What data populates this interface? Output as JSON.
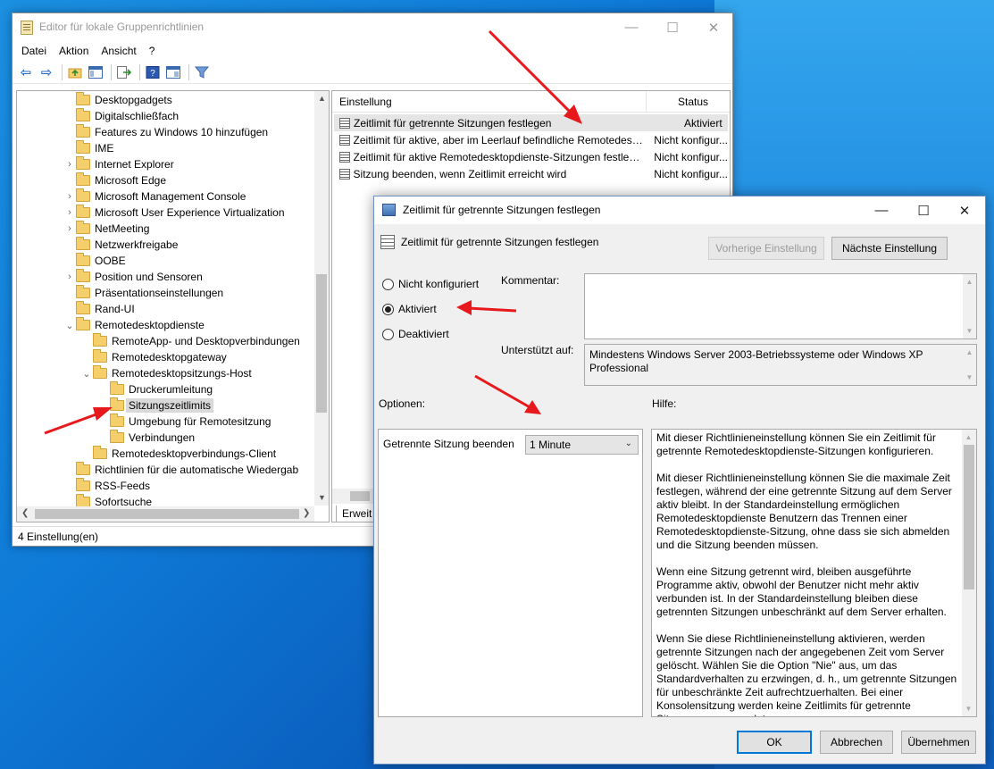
{
  "editor": {
    "title": "Editor für lokale Gruppenrichtlinien",
    "menu": [
      "Datei",
      "Aktion",
      "Ansicht",
      "?"
    ],
    "tree_items": [
      {
        "label": "Desktopgadgets",
        "expander": ""
      },
      {
        "label": "Digitalschließfach",
        "expander": ""
      },
      {
        "label": "Features zu Windows 10 hinzufügen",
        "expander": ""
      },
      {
        "label": "IME",
        "expander": ""
      },
      {
        "label": "Internet Explorer",
        "expander": ">"
      },
      {
        "label": "Microsoft Edge",
        "expander": ""
      },
      {
        "label": "Microsoft Management Console",
        "expander": ">"
      },
      {
        "label": "Microsoft User Experience Virtualization",
        "expander": ">"
      },
      {
        "label": "NetMeeting",
        "expander": ">"
      },
      {
        "label": "Netzwerkfreigabe",
        "expander": ""
      },
      {
        "label": "OOBE",
        "expander": ""
      },
      {
        "label": "Position und Sensoren",
        "expander": ">"
      },
      {
        "label": "Präsentationseinstellungen",
        "expander": ""
      },
      {
        "label": "Rand-UI",
        "expander": ""
      },
      {
        "label": "Remotedesktopdienste",
        "expander": "v"
      },
      {
        "label": "RemoteApp- und Desktopverbindungen",
        "expander": ""
      },
      {
        "label": "Remotedesktopgateway",
        "expander": ""
      },
      {
        "label": "Remotedesktopsitzungs-Host",
        "expander": "v"
      },
      {
        "label": "Druckerumleitung",
        "expander": ""
      },
      {
        "label": "Sitzungszeitlimits",
        "expander": ""
      },
      {
        "label": "Umgebung für Remotesitzung",
        "expander": ""
      },
      {
        "label": "Verbindungen",
        "expander": ""
      },
      {
        "label": "Remotedesktopverbindungs-Client",
        "expander": ""
      },
      {
        "label": "Richtlinien für die automatische Wiedergab",
        "expander": ""
      },
      {
        "label": "RSS-Feeds",
        "expander": ""
      },
      {
        "label": "Sofortsuche",
        "expander": ""
      }
    ],
    "list_header": {
      "setting": "Einstellung",
      "status": "Status"
    },
    "list_rows": [
      {
        "name": "Zeitlimit für getrennte Sitzungen festlegen",
        "status": "Aktiviert"
      },
      {
        "name": "Zeitlimit für aktive, aber im Leerlauf befindliche Remotedesk...",
        "status": "Nicht konfigur..."
      },
      {
        "name": "Zeitlimit für aktive Remotedesktopdienste-Sitzungen festleg...",
        "status": "Nicht konfigur..."
      },
      {
        "name": "Sitzung beenden, wenn Zeitlimit erreicht wird",
        "status": "Nicht konfigur..."
      }
    ],
    "bottom_tab": "Erweit",
    "statusbar": "4 Einstellung(en)"
  },
  "dialog": {
    "title": "Zeitlimit für getrennte Sitzungen festlegen",
    "header": "Zeitlimit für getrennte Sitzungen festlegen",
    "prev_button": "Vorherige Einstellung",
    "next_button": "Nächste Einstellung",
    "radio": {
      "not_configured": "Nicht konfiguriert",
      "enabled": "Aktiviert",
      "disabled": "Deaktiviert",
      "selected": "enabled"
    },
    "comment_label": "Kommentar:",
    "supported_label": "Unterstützt auf:",
    "supported_text": "Mindestens Windows Server 2003-Betriebssysteme oder Windows XP Professional",
    "options_label": "Optionen:",
    "help_label": "Hilfe:",
    "option_name": "Getrennte Sitzung beenden",
    "option_value": "1 Minute",
    "help_text": "Mit dieser Richtlinieneinstellung können Sie ein Zeitlimit für getrennte Remotedesktopdienste-Sitzungen konfigurieren.\n\nMit dieser Richtlinieneinstellung können Sie die maximale Zeit festlegen, während der eine getrennte Sitzung auf dem Server aktiv bleibt. In der Standardeinstellung ermöglichen Remotedesktopdienste Benutzern das Trennen einer Remotedesktopdienste-Sitzung, ohne dass sie sich abmelden und die Sitzung beenden müssen.\n\nWenn eine Sitzung getrennt wird, bleiben ausgeführte Programme aktiv, obwohl der Benutzer nicht mehr aktiv verbunden ist. In der Standardeinstellung bleiben diese getrennten Sitzungen unbeschränkt auf dem Server erhalten.\n\nWenn Sie diese Richtlinieneinstellung aktivieren, werden getrennte Sitzungen nach der angegebenen Zeit vom Server gelöscht. Wählen Sie die Option \"Nie\" aus, um das Standardverhalten zu erzwingen, d. h., um getrennte Sitzungen für unbeschränkte Zeit aufrechtzuerhalten. Bei einer Konsolensitzung werden keine Zeitlimits für getrennte Sitzungen angewendet.",
    "ok": "OK",
    "cancel": "Abbrechen",
    "apply": "Übernehmen"
  },
  "colors": {
    "annotation_arrow": "#e8191d",
    "desktop": "#0f7bd8",
    "default_button_border": "#0078d7"
  }
}
